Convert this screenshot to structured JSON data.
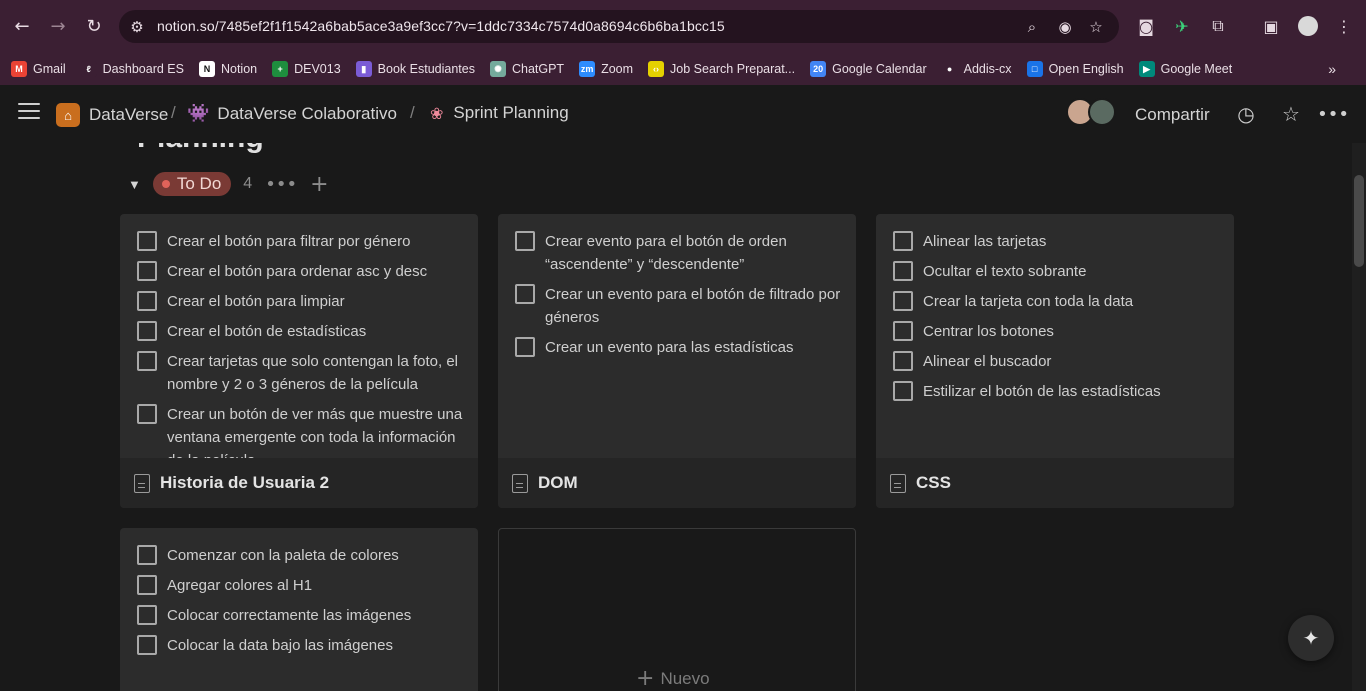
{
  "browser": {
    "url": "notion.so/7485ef2f1f1542a6bab5ace3a9ef3cc7?v=1ddc7334c7574d0a8694c6b6ba1bcc15",
    "bookmarks": [
      {
        "label": "Gmail",
        "icon": "gmail-icon",
        "color": "#ea4335",
        "glyph": "M"
      },
      {
        "label": "Dashboard ES",
        "icon": "laboratoria-icon",
        "color": "#3b1f33",
        "glyph": "ℓ"
      },
      {
        "label": "Notion",
        "icon": "notion-icon",
        "color": "#ffffff",
        "glyph": "N"
      },
      {
        "label": "DEV013",
        "icon": "sheets-icon",
        "color": "#1e8e3e",
        "glyph": "+"
      },
      {
        "label": "Book Estudiantes",
        "icon": "book-icon",
        "color": "#7b5cd6",
        "glyph": "▮"
      },
      {
        "label": "ChatGPT",
        "icon": "chatgpt-icon",
        "color": "#74aa9c",
        "glyph": "✺"
      },
      {
        "label": "Zoom",
        "icon": "zoom-icon",
        "color": "#2d8cff",
        "glyph": "zm"
      },
      {
        "label": "Job Search Preparat...",
        "icon": "job-icon",
        "color": "#e5d100",
        "glyph": "‹›"
      },
      {
        "label": "Google Calendar",
        "icon": "calendar-icon",
        "color": "#4285f4",
        "glyph": "20"
      },
      {
        "label": "Addis-cx",
        "icon": "github-icon",
        "color": "#3b1f33",
        "glyph": "●"
      },
      {
        "label": "Open English",
        "icon": "openenglish-icon",
        "color": "#1a73e8",
        "glyph": "□"
      },
      {
        "label": "Google Meet",
        "icon": "meet-icon",
        "color": "#00897b",
        "glyph": "▶"
      }
    ]
  },
  "topbar": {
    "crumbs": [
      "DataVerse",
      "DataVerse Colaborativo",
      "Sprint Planning"
    ],
    "share_label": "Compartir"
  },
  "page_title_partial": "Planning",
  "group": {
    "status": "To Do",
    "count": "4"
  },
  "cards": [
    {
      "title": "Historia de Usuaria 2",
      "todos": [
        "Crear el botón para filtrar por género",
        "Crear el botón para ordenar asc y desc",
        "Crear el botón para limpiar",
        "Crear el botón de estadísticas",
        "Crear tarjetas que solo contengan la foto, el nombre y 2 o 3 géneros de la película",
        "Crear un botón de ver más que muestre una ventana emergente con toda la información de la película"
      ]
    },
    {
      "title": "DOM",
      "todos": [
        "Crear evento para el botón de orden “ascendente” y “descendente”",
        "Crear un evento para el botón de filtrado por géneros",
        "Crear un evento para las estadísticas"
      ]
    },
    {
      "title": "CSS",
      "todos": [
        "Alinear las tarjetas",
        "Ocultar el texto sobrante",
        "Crear la tarjeta con toda la data",
        "Centrar los botones",
        "Alinear el buscador",
        "Estilizar el botón de las estadísticas"
      ]
    },
    {
      "title": "",
      "todos": [
        "Comenzar con la paleta de colores",
        "Agregar colores al H1",
        "Colocar correctamente las imágenes",
        "Colocar la data bajo las imágenes"
      ]
    }
  ],
  "new_card_label": "Nuevo"
}
